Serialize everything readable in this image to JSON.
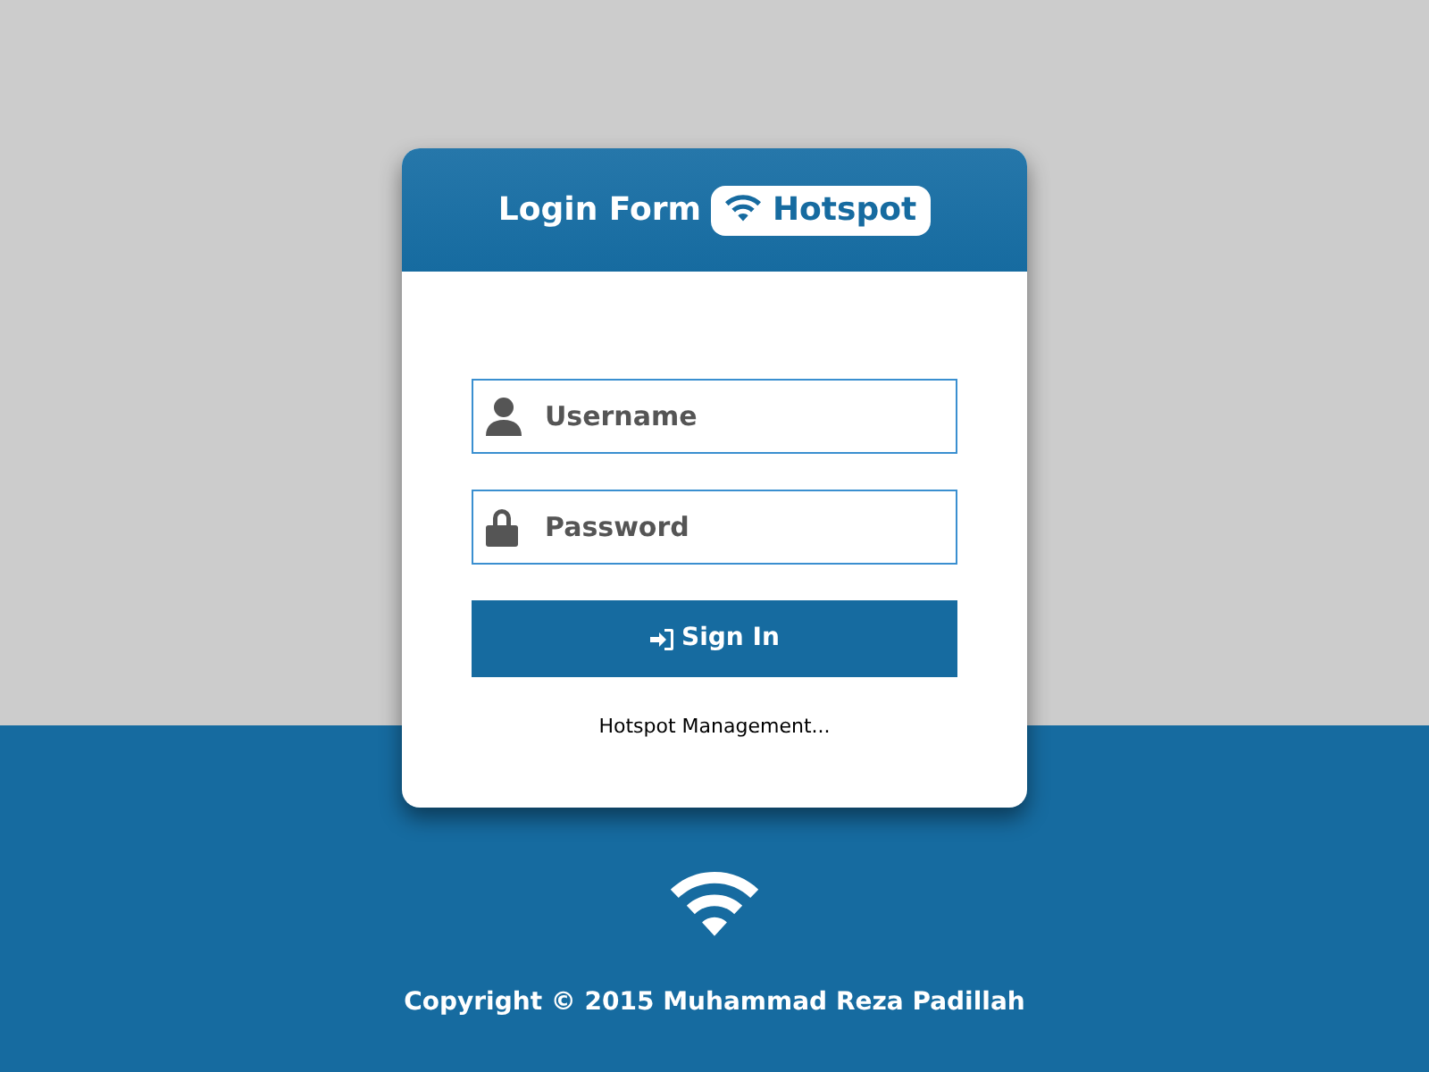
{
  "header": {
    "title": "Login Form",
    "badge": "Hotspot"
  },
  "fields": [
    {
      "kind": "user",
      "placeholder": "Username"
    },
    {
      "kind": "lock",
      "placeholder": "Password"
    }
  ],
  "sign_in_button": "Sign In",
  "footer_link": "Hotspot Management...",
  "copyright": "Copyright © 2015 Muhammad Reza Padillah"
}
